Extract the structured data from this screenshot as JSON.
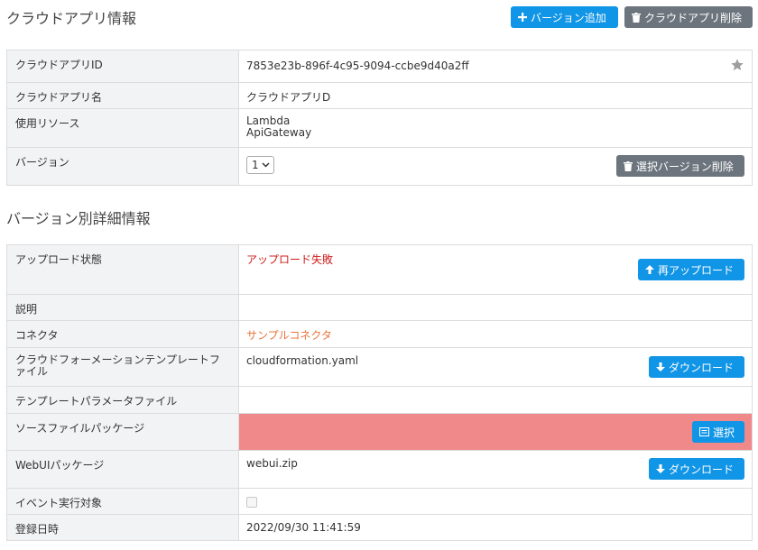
{
  "page": {
    "title": "クラウドアプリ情報",
    "add_version_label": "バージョン追加",
    "delete_app_label": "クラウドアプリ削除"
  },
  "app_info": {
    "id_label": "クラウドアプリID",
    "id_value": "7853e23b-896f-4c95-9094-ccbe9d40a2ff",
    "name_label": "クラウドアプリ名",
    "name_value": "クラウドアプリD",
    "resources_label": "使用リソース",
    "resources": [
      "Lambda",
      "ApiGateway"
    ],
    "version_label": "バージョン",
    "version_selected": "1",
    "delete_version_label": "選択バージョン削除"
  },
  "version_detail": {
    "title": "バージョン別詳細情報",
    "upload_status_label": "アップロード状態",
    "upload_status_value": "アップロード失敗",
    "reupload_label": "再アップロード",
    "description_label": "説明",
    "description_value": "",
    "connector_label": "コネクタ",
    "connector_value": "サンプルコネクタ",
    "cf_template_label": "クラウドフォーメーションテンプレートファイル",
    "cf_template_value": "cloudformation.yaml",
    "download_label": "ダウンロード",
    "template_params_label": "テンプレートパラメータファイル",
    "template_params_value": "",
    "source_package_label": "ソースファイルパッケージ",
    "select_label": "選択",
    "webui_package_label": "WebUIパッケージ",
    "webui_package_value": "webui.zip",
    "event_target_label": "イベント実行対象",
    "event_target_checked": false,
    "registered_label": "登録日時",
    "registered_value": "2022/09/30 11:41:59"
  },
  "colors": {
    "primary": "#1195e6",
    "secondary": "#6c757d",
    "error_text": "#d01a1a",
    "connector_text": "#e8743b",
    "error_cell": "#f08a8a",
    "label_bg": "#f1f3f5"
  }
}
